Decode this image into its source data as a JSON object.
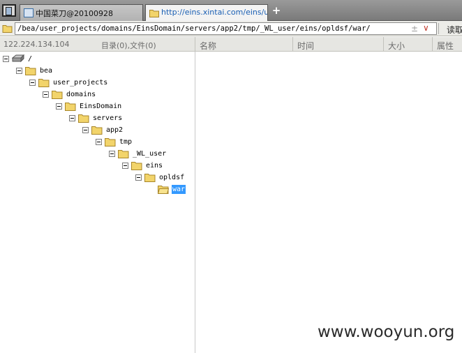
{
  "tabs": [
    {
      "label": "中国菜刀@20100928",
      "active": false
    },
    {
      "label": "http://eins.xintai.com/eins/up...",
      "active": true
    }
  ],
  "address": {
    "path": "/bea/user_projects/domains/EinsDomain/servers/app2/tmp/_WL_user/eins/opldsf/war/",
    "go_symbol": "±",
    "dropdown_symbol": "∨",
    "read_button": "读取"
  },
  "info": {
    "ip": "122.224.134.104",
    "counts": "目录(0),文件(0)"
  },
  "columns": {
    "name": "名称",
    "time": "时间",
    "size": "大小",
    "attr": "属性"
  },
  "tree": [
    {
      "label": "/",
      "depth": 0,
      "icon": "drive-icon",
      "selected": false
    },
    {
      "label": "bea",
      "depth": 1,
      "icon": "folder-icon",
      "selected": false
    },
    {
      "label": "user_projects",
      "depth": 2,
      "icon": "folder-icon",
      "selected": false
    },
    {
      "label": "domains",
      "depth": 3,
      "icon": "folder-icon",
      "selected": false
    },
    {
      "label": "EinsDomain",
      "depth": 4,
      "icon": "folder-icon",
      "selected": false
    },
    {
      "label": "servers",
      "depth": 5,
      "icon": "folder-icon",
      "selected": false
    },
    {
      "label": "app2",
      "depth": 6,
      "icon": "folder-icon",
      "selected": false
    },
    {
      "label": "tmp",
      "depth": 7,
      "icon": "folder-icon",
      "selected": false
    },
    {
      "label": "_WL_user",
      "depth": 8,
      "icon": "folder-icon",
      "selected": false
    },
    {
      "label": "eins",
      "depth": 9,
      "icon": "folder-icon",
      "selected": false
    },
    {
      "label": "opldsf",
      "depth": 10,
      "icon": "folder-icon",
      "selected": false
    },
    {
      "label": "war",
      "depth": 11,
      "icon": "folder-open-icon",
      "selected": true
    }
  ],
  "watermark": "www.wooyun.org",
  "colors": {
    "selection": "#3399ff",
    "folder": "#f2d46b",
    "link": "#1a5fb4"
  }
}
